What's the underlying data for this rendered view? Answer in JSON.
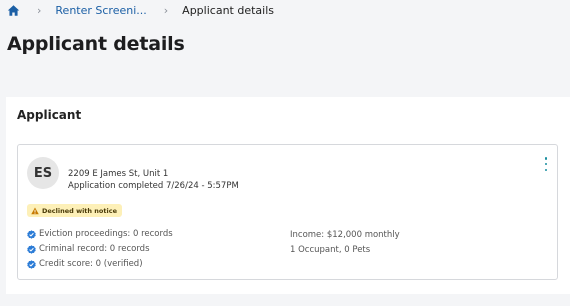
{
  "breadcrumb": {
    "items": [
      "Renter Screeni...",
      "Applicant details"
    ]
  },
  "page": {
    "title": "Applicant details"
  },
  "panel": {
    "title": "Applicant"
  },
  "applicant": {
    "initials": "ES",
    "address": "2209 E James St, Unit 1",
    "completed": "Application completed 7/26/24 - 5:57PM",
    "status_badge": "Declined with notice",
    "checks": [
      "Eviction proceedings: 0 records",
      "Criminal record: 0 records",
      "Credit score: 0 (verified)"
    ],
    "income": "Income: $12,000 monthly",
    "household": "1 Occupant, 0 Pets"
  },
  "colors": {
    "link": "#1b5fa5",
    "check": "#2a7bd6",
    "badge_bg": "#fdf0b8",
    "kebab": "#1a8fa0"
  }
}
